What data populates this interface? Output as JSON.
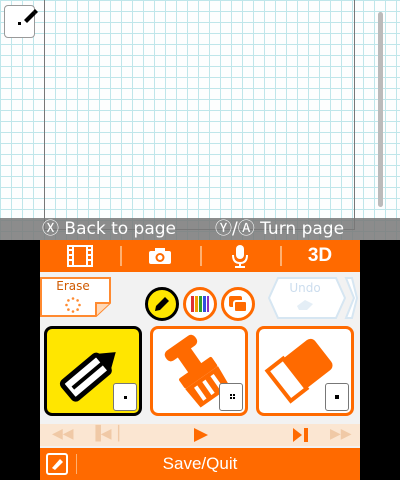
{
  "hints": {
    "back_to_page": "Ⓧ Back to page",
    "turn_page": "Ⓨ/Ⓐ Turn page"
  },
  "toolbar": {
    "items": [
      "film-icon",
      "camera-icon",
      "microphone-icon",
      "3D"
    ],
    "three_d_label": "3D"
  },
  "tools": {
    "erase_label": "Erase",
    "undo_label": "Undo",
    "selected_tool": "pencil",
    "cards": [
      "pencil",
      "paint-brush",
      "eraser"
    ]
  },
  "footer": {
    "save_label": "Save/Quit"
  },
  "colors": {
    "accent": "#ff6a00",
    "selected": "#ffe600",
    "grid": "#bfe6ea"
  }
}
